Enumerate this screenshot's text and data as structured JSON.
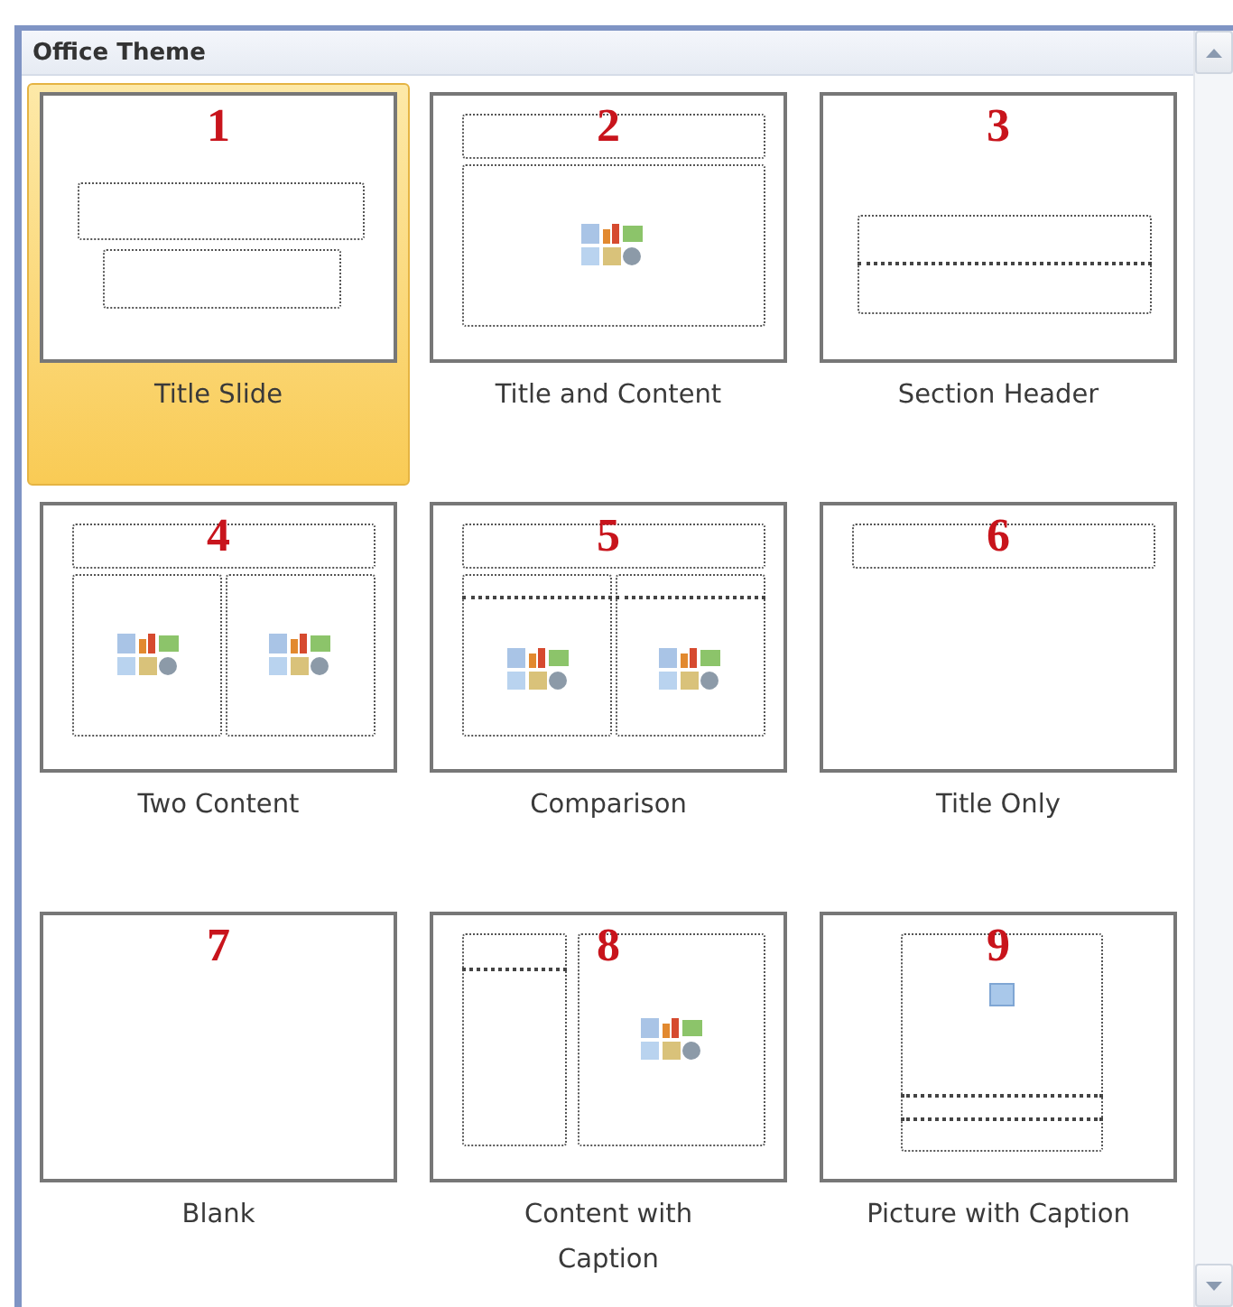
{
  "gallery": {
    "title": "Office Theme",
    "layouts": [
      {
        "number": "1",
        "label": "Title Slide",
        "kind": "title",
        "selected": true
      },
      {
        "number": "2",
        "label": "Title and Content",
        "kind": "title-content",
        "selected": false
      },
      {
        "number": "3",
        "label": "Section Header",
        "kind": "section",
        "selected": false
      },
      {
        "number": "4",
        "label": "Two Content",
        "kind": "two-content",
        "selected": false
      },
      {
        "number": "5",
        "label": "Comparison",
        "kind": "comparison",
        "selected": false
      },
      {
        "number": "6",
        "label": "Title Only",
        "kind": "title-only",
        "selected": false
      },
      {
        "number": "7",
        "label": "Blank",
        "kind": "blank",
        "selected": false
      },
      {
        "number": "8",
        "label": "Content with Caption",
        "kind": "content-caption",
        "selected": false
      },
      {
        "number": "9",
        "label": "Picture with Caption",
        "kind": "picture-caption",
        "selected": false
      }
    ]
  }
}
